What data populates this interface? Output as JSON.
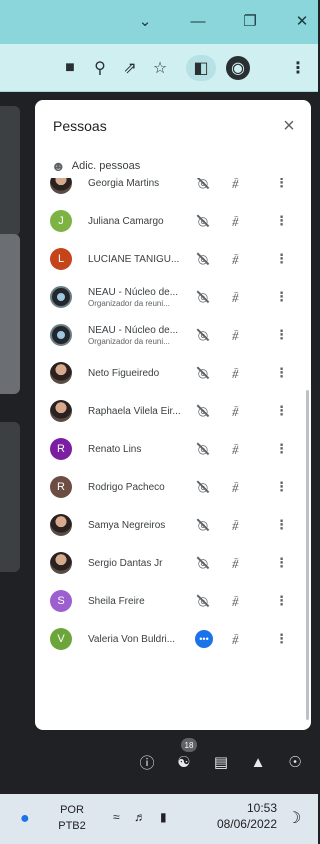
{
  "window": {
    "controls": [
      "chevron-down-icon",
      "minimize-icon",
      "restore-icon",
      "close-icon"
    ]
  },
  "toolbar": {
    "icons": [
      "camera-icon",
      "zoom-icon",
      "share-icon",
      "star-icon",
      "sidebar-icon",
      "profile-icon",
      "menu-icon"
    ]
  },
  "panel": {
    "title": "Pessoas",
    "close_icon": "×",
    "add_label": "Adic. pessoas",
    "participants": [
      {
        "name": "Georgia Martins",
        "subtitle": "",
        "initial": "",
        "avatar": "photo",
        "color": "#9aa0a6",
        "mic": "muted"
      },
      {
        "name": "Juliana Camargo",
        "subtitle": "",
        "initial": "J",
        "avatar": "letter",
        "color": "#7cb342",
        "mic": "muted"
      },
      {
        "name": "LUCIANE TANIGU...",
        "subtitle": "",
        "initial": "L",
        "avatar": "letter",
        "color": "#c5441a",
        "mic": "muted"
      },
      {
        "name": "NEAU - Núcleo de...",
        "subtitle": "Organizador da reuni...",
        "initial": "",
        "avatar": "logo",
        "color": "#23272b",
        "mic": "muted"
      },
      {
        "name": "NEAU - Núcleo de...",
        "subtitle": "Organizador da reuni...",
        "initial": "",
        "avatar": "logo",
        "color": "#23272b",
        "mic": "muted"
      },
      {
        "name": "Neto Figueiredo",
        "subtitle": "",
        "initial": "",
        "avatar": "photo",
        "color": "#2a2220",
        "mic": "muted"
      },
      {
        "name": "Raphaela Vilela Eir...",
        "subtitle": "",
        "initial": "",
        "avatar": "photo",
        "color": "#2a2220",
        "mic": "muted"
      },
      {
        "name": "Renato Lins",
        "subtitle": "",
        "initial": "R",
        "avatar": "letter",
        "color": "#7b1fa2",
        "mic": "muted"
      },
      {
        "name": "Rodrigo Pacheco",
        "subtitle": "",
        "initial": "R",
        "avatar": "letter",
        "color": "#6d4c41",
        "mic": "muted"
      },
      {
        "name": "Samya Negreiros",
        "subtitle": "",
        "initial": "",
        "avatar": "photo",
        "color": "#2a2220",
        "mic": "muted"
      },
      {
        "name": "Sergio Dantas Jr",
        "subtitle": "",
        "initial": "",
        "avatar": "photo",
        "color": "#2a2220",
        "mic": "muted"
      },
      {
        "name": "Sheila Freire",
        "subtitle": "",
        "initial": "S",
        "avatar": "letter",
        "color": "#9c5fd0",
        "mic": "muted"
      },
      {
        "name": "Valeria Von Buldri...",
        "subtitle": "",
        "initial": "V",
        "avatar": "letter",
        "color": "#6ca63a",
        "mic": "more"
      }
    ]
  },
  "meet_bar": {
    "people_count": "18",
    "icons": [
      "info-icon",
      "people-icon",
      "chat-icon",
      "activities-icon",
      "host-controls-icon"
    ]
  },
  "taskbar": {
    "lang_top": "POR",
    "lang_bottom": "PTB2",
    "time": "10:53",
    "date": "08/06/2022"
  }
}
